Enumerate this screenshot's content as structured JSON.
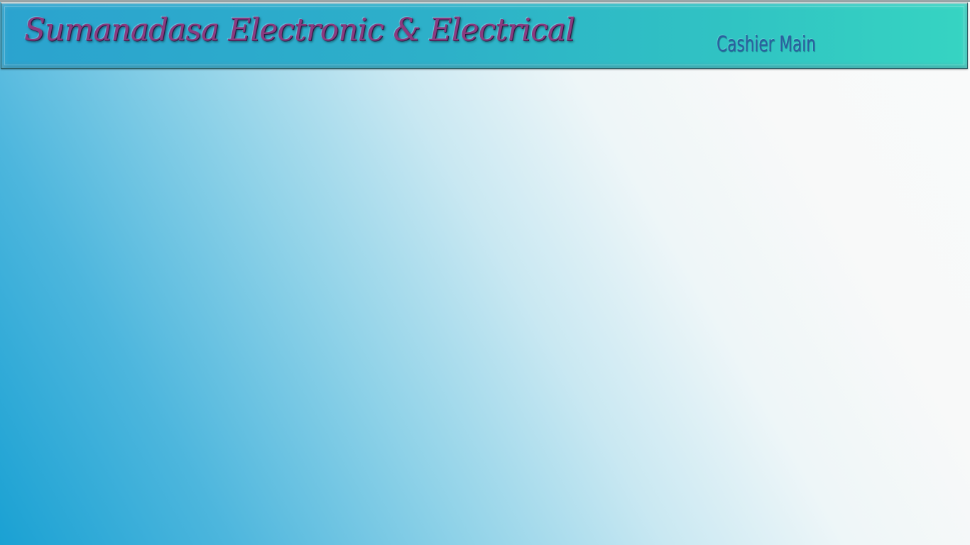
{
  "header": {
    "brand_title": "Sumanadasa Electronic & Electrical",
    "screen_title": "Cashier Main"
  },
  "colors": {
    "header_gradient_start": "#2ba3cf",
    "header_gradient_end": "#36d4c2",
    "brand_title_color": "#8b3a7f",
    "screen_title_color": "#2b5fa0",
    "background_left": "#1aa1d3",
    "background_right": "#f9fafa"
  }
}
